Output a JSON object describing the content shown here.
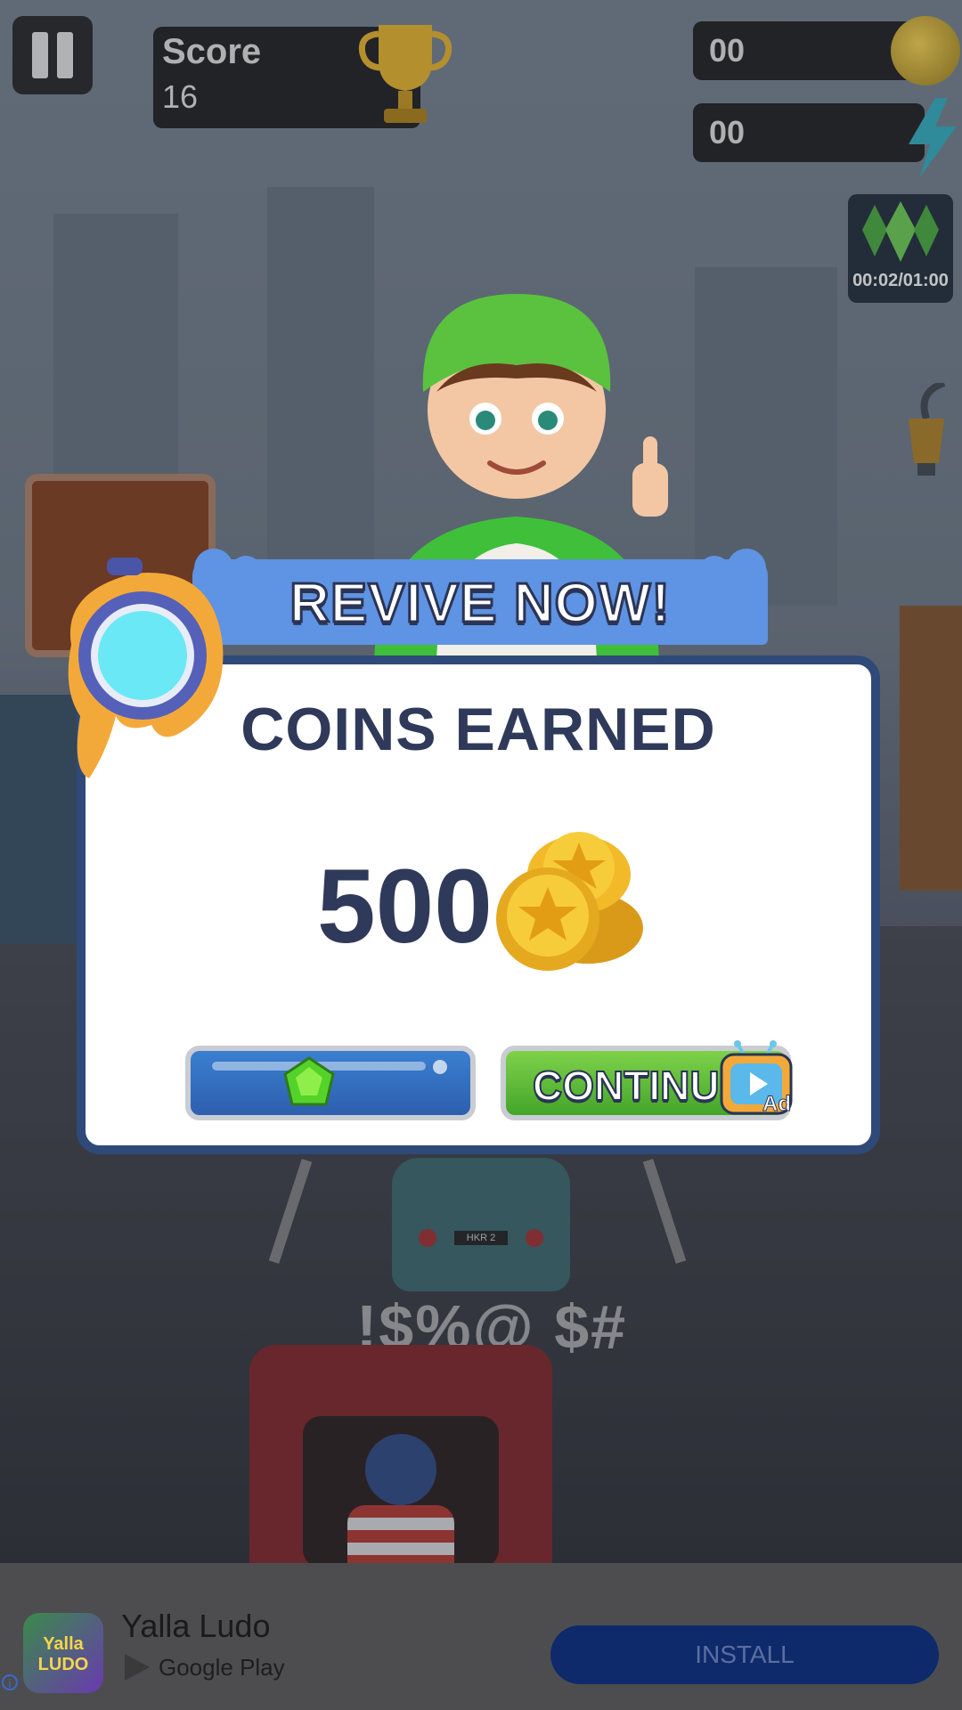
{
  "hud": {
    "score_label": "Score",
    "score_value": "16",
    "coins_count": "00",
    "energy_count": "00",
    "gem_timer": "00:02/01:00"
  },
  "modal": {
    "banner_title": "REVIVE NOW!",
    "title": "COINS EARNED",
    "coins_value": "500",
    "continue_label": "CONTINUE",
    "ad_badge": "Ad"
  },
  "background": {
    "swear_text": "!$%@ $#",
    "car_plate": "HKR 2"
  },
  "ad": {
    "icon_text": "Yalla LUDO",
    "app_name": "Yalla Ludo",
    "store_name": "Google Play",
    "install_label": "INSTALL",
    "info_glyph": "i"
  },
  "colors": {
    "banner_blue": "#5f93e3",
    "panel_border": "#2f4a78",
    "title_navy": "#2f3a5a",
    "revive_button": "#3a7fd0",
    "continue_button": "#5cbf36",
    "install_button": "#0f2a6a"
  }
}
